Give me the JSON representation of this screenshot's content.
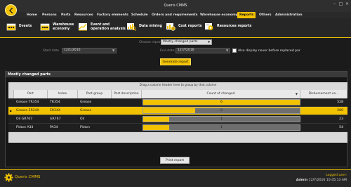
{
  "window": {
    "title": "Queris CMMS"
  },
  "colors": {
    "accent": "#f2c200",
    "background": "#1e1e1e"
  },
  "menu": [
    {
      "label": "Home"
    },
    {
      "label": "Persons"
    },
    {
      "label": "Parts"
    },
    {
      "label": "Resources"
    },
    {
      "label": "Factory elements"
    },
    {
      "label": "Schedule"
    },
    {
      "label": "Orders and requirements"
    },
    {
      "label": "Warehouse economy"
    },
    {
      "label": "Reports"
    },
    {
      "label": "Others"
    },
    {
      "label": "Administration"
    }
  ],
  "toolbar": [
    {
      "label": "Events",
      "icon": "calendar-icon"
    },
    {
      "label": "Warehouse\neconomy",
      "icon": "calendar-icon"
    },
    {
      "label": "Event and\noperation analysis",
      "icon": "chart-icon"
    },
    {
      "label": "Data mining",
      "icon": "data-mining-icon"
    },
    {
      "label": "Cost reports",
      "icon": "cost-report-icon"
    },
    {
      "label": "Resources reports",
      "icon": "gear-report-icon"
    }
  ],
  "controls": {
    "choose_report_label": "Choose report:",
    "report_value": "Mostly changed parts",
    "start_date_label": "Start date",
    "start_date_value": "12/1/2016",
    "end_date_label": "End date",
    "end_date_value": "12/7/2016",
    "also_display_label": "Also display never before replaced par",
    "generate_label": "Generate report"
  },
  "panel": {
    "title": "Mostly changed parts",
    "group_hint": "Drag a column header here to group by that column",
    "columns": [
      "Part",
      "Index",
      "Part group",
      "Part description",
      "Count of changed",
      "Disbursement va..."
    ],
    "rows": [
      {
        "part": "Grease TR354",
        "index": "TR354",
        "group": "Grease",
        "description": "",
        "count": 6,
        "count_label": "6",
        "disbursement": "528",
        "selected": false
      },
      {
        "part": "Grease ER24X",
        "index": "ER24X",
        "group": "Grease",
        "description": "",
        "count": 2,
        "count_label": "2",
        "disbursement": "200",
        "selected": true
      },
      {
        "part": "Oil GR767",
        "index": "GR767",
        "group": "Oil",
        "description": "",
        "count": 1,
        "count_label": "1",
        "disbursement": "23",
        "selected": false
      },
      {
        "part": "Piston A34",
        "index": "PA34",
        "group": "Piston",
        "description": "",
        "count": 1,
        "count_label": "1",
        "disbursement": "54",
        "selected": false
      }
    ],
    "count_max": 6,
    "print_label": "Print report"
  },
  "status": {
    "app_name": "Queris CMMS",
    "logged_user_label": "Logged user:",
    "user": "Admin",
    "timestamp": "12/7/2016 10:45:13 AM"
  }
}
